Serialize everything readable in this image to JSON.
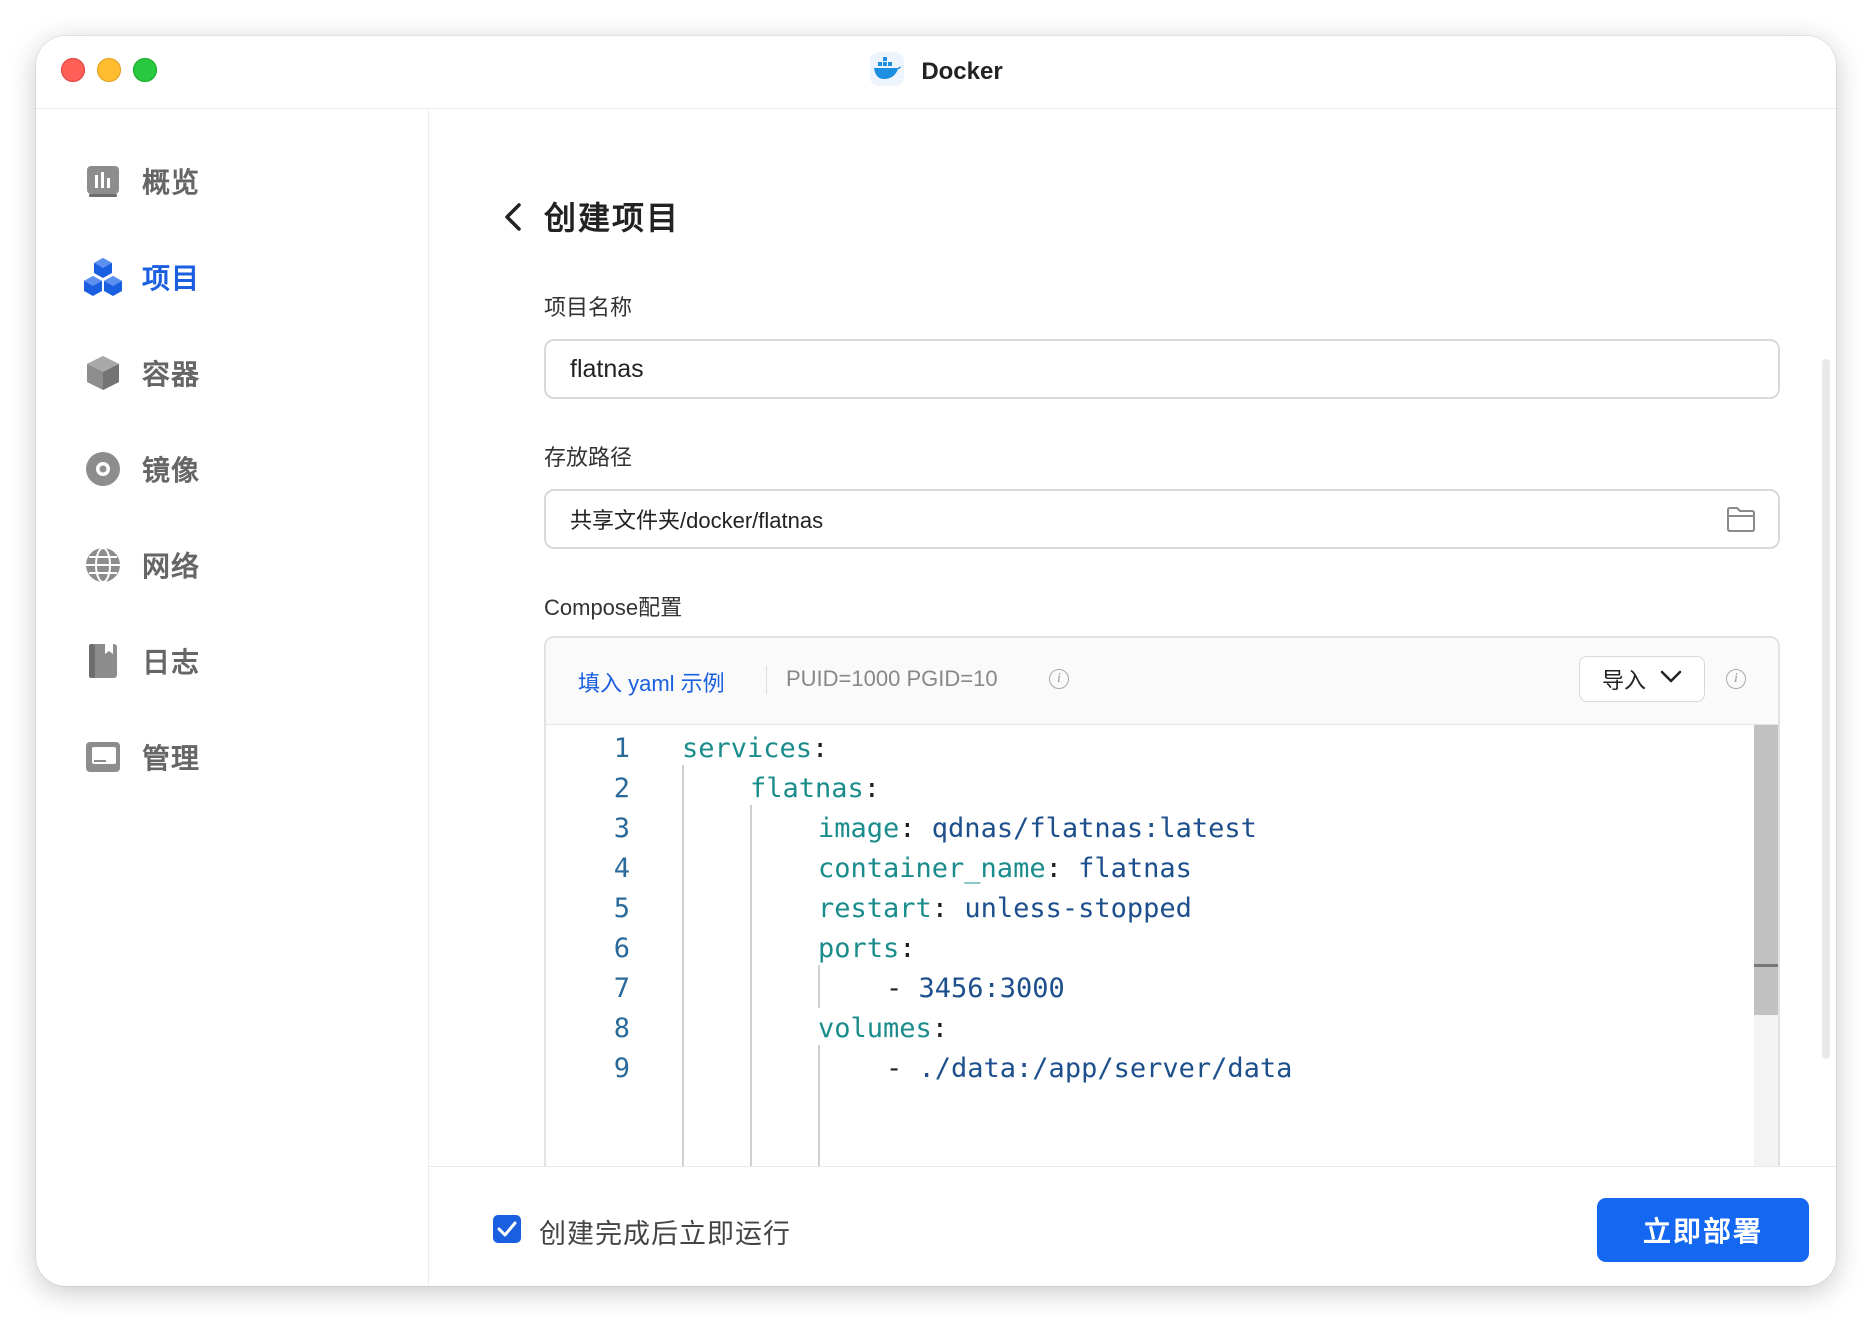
{
  "window": {
    "title": "Docker",
    "app_icon": "docker-whale-icon"
  },
  "sidebar": {
    "items": [
      {
        "label": "概览",
        "icon": "bar-chart-icon",
        "active": false
      },
      {
        "label": "项目",
        "icon": "cubes-icon",
        "active": true
      },
      {
        "label": "容器",
        "icon": "box-icon",
        "active": false
      },
      {
        "label": "镜像",
        "icon": "disc-icon",
        "active": false
      },
      {
        "label": "网络",
        "icon": "globe-icon",
        "active": false
      },
      {
        "label": "日志",
        "icon": "book-icon",
        "active": false
      },
      {
        "label": "管理",
        "icon": "tray-icon",
        "active": false
      }
    ]
  },
  "main": {
    "title": "创建项目",
    "project_name": {
      "label": "项目名称",
      "value": "flatnas"
    },
    "storage_path": {
      "label": "存放路径",
      "value": "共享文件夹/docker/flatnas"
    },
    "compose": {
      "label": "Compose配置",
      "fill_yaml_label": "填入 yaml 示例",
      "puid_text": "PUID=1000 PGID=10",
      "import_label": "导入",
      "lines": [
        {
          "n": "1",
          "key": "services",
          "val": ""
        },
        {
          "n": "2",
          "key": "flatnas",
          "val": ""
        },
        {
          "n": "3",
          "key": "image",
          "val": "qdnas/flatnas:latest"
        },
        {
          "n": "4",
          "key": "container_name",
          "val": "flatnas"
        },
        {
          "n": "5",
          "key": "restart",
          "val": "unless-stopped"
        },
        {
          "n": "6",
          "key": "ports",
          "val": ""
        },
        {
          "n": "7",
          "key": "",
          "val": "3456:3000"
        },
        {
          "n": "8",
          "key": "volumes",
          "val": ""
        },
        {
          "n": "9",
          "key": "",
          "val": "./data:/app/server/data"
        }
      ]
    },
    "footer": {
      "run_after_create_label": "创建完成后立即运行",
      "run_after_create_checked": true,
      "deploy_label": "立即部署"
    }
  },
  "colors": {
    "accent": "#1a5fe0",
    "button": "#1467f0",
    "yaml_key": "#1b8c8c",
    "yaml_value": "#1c4f8c"
  }
}
